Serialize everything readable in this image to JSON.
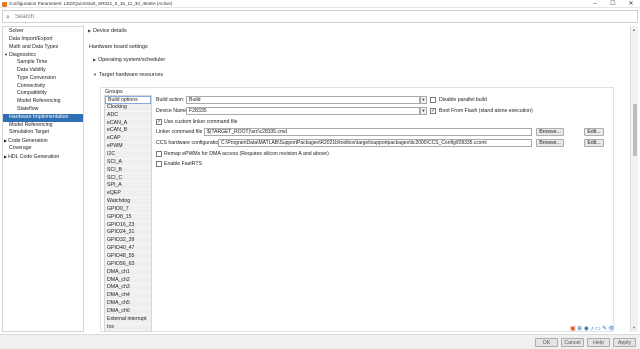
{
  "window": {
    "title": "Configuration Parameters: LED/QuickStart_SR021_5_16_11_30_4848A (Active)",
    "minimize": "–",
    "maximize": "☐",
    "close": "✕"
  },
  "search": {
    "placeholder": "Search",
    "value": ""
  },
  "tree": [
    {
      "label": "Solver",
      "level": 0,
      "arrow": ""
    },
    {
      "label": "Data Import/Export",
      "level": 0,
      "arrow": ""
    },
    {
      "label": "Math and Data Types",
      "level": 0,
      "arrow": ""
    },
    {
      "label": "Diagnostics",
      "level": 0,
      "arrow": "▼"
    },
    {
      "label": "Sample Time",
      "level": 1,
      "arrow": ""
    },
    {
      "label": "Data Validity",
      "level": 1,
      "arrow": ""
    },
    {
      "label": "Type Conversion",
      "level": 1,
      "arrow": ""
    },
    {
      "label": "Connectivity",
      "level": 1,
      "arrow": ""
    },
    {
      "label": "Compatibility",
      "level": 1,
      "arrow": ""
    },
    {
      "label": "Model Referencing",
      "level": 1,
      "arrow": ""
    },
    {
      "label": "Stateflow",
      "level": 1,
      "arrow": ""
    },
    {
      "label": "Hardware Implementation",
      "level": 0,
      "arrow": "",
      "selected": true
    },
    {
      "label": "Model Referencing",
      "level": 0,
      "arrow": ""
    },
    {
      "label": "Simulation Target",
      "level": 0,
      "arrow": ""
    },
    {
      "label": "Code Generation",
      "level": 0,
      "arrow": "▶"
    },
    {
      "label": "Coverage",
      "level": 0,
      "arrow": ""
    },
    {
      "label": "HDL Code Generation",
      "level": 0,
      "arrow": "▶"
    }
  ],
  "content": {
    "device_details": "Device details",
    "hw_board_settings": "Hardware board settings",
    "os_scheduler": "Operating system/scheduler",
    "target_hw_resources": "Target hardware resources",
    "groups_label": "Groups"
  },
  "groups": [
    "Build options",
    "Clocking",
    "ADC",
    "eCAN_A",
    "eCAN_B",
    "eCAP",
    "ePWM",
    "I2C",
    "SCI_A",
    "SCI_B",
    "SCI_C",
    "SPI_A",
    "eQEP",
    "Watchdog",
    "GPIO0_7",
    "GPIO8_15",
    "GPIO16_23",
    "GPIO24_31",
    "GPIO32_39",
    "GPIO40_47",
    "GPIO48_55",
    "GPIO56_63",
    "DMA_ch1",
    "DMA_ch2",
    "DMA_ch3",
    "DMA_ch4",
    "DMA_ch5",
    "DMA_ch6",
    "External interrupt",
    "Ins"
  ],
  "build_options": {
    "build_action_label": "Build action:",
    "build_action_value": "Build",
    "disable_parallel_label": "Disable parallel build",
    "device_name_label": "Device Name",
    "device_name_value": "F28335",
    "boot_flash_label": "Boot From Flash (stand alone execution)",
    "custom_linker_label": "Use custom linker command file",
    "linker_file_label": "Linker command file",
    "linker_file_value": "$(TARGET_ROOT)\\src\\c28335.cmd",
    "ccs_config_label": "CCS hardware configuration file",
    "ccs_config_value": "C:\\ProgramData\\MATLAB\\SupportPackages\\R2021b\\toolbox\\target\\supportpackages\\tic2000\\CCS_Config\\f28335.ccxml",
    "remap_label": "Remap ePWMs for DMA access (Requires silicon revision A and above)",
    "fastrts_label": "Enable FastRTS",
    "browse_label": "Browse...",
    "edit_label": "Edit..."
  },
  "checkbox_states": {
    "disable_parallel": false,
    "boot_flash": true,
    "custom_linker": true,
    "remap": false,
    "fastrts": false
  },
  "footer": {
    "ok": "OK",
    "cancel": "Cancel",
    "help": "Help",
    "apply": "Apply"
  },
  "tray_icons": [
    "matlab-icon",
    "language-icon",
    "network-icon",
    "volume-icon",
    "battery-icon",
    "pen-icon",
    "settings-icon"
  ]
}
